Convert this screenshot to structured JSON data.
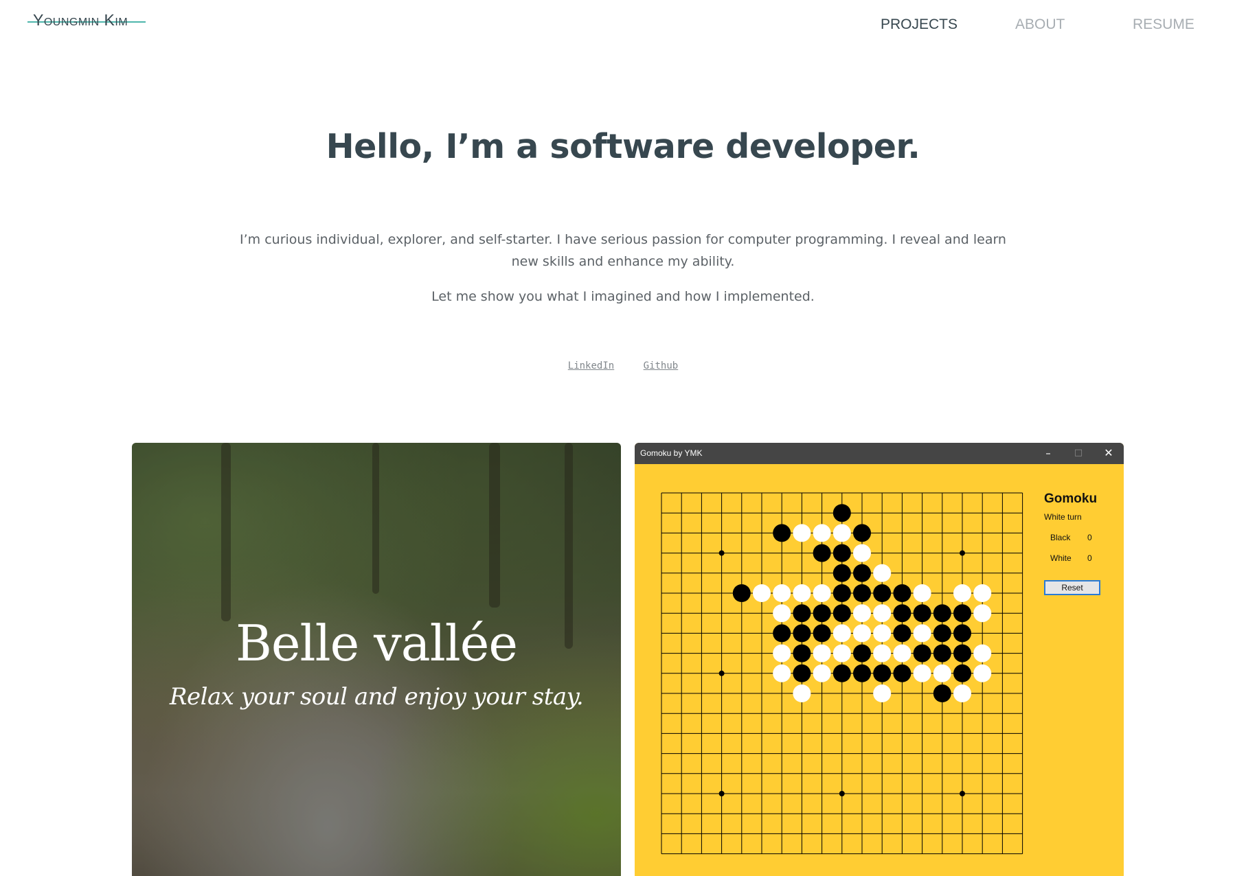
{
  "header": {
    "logo": "Youngmin Kim",
    "nav": {
      "projects": "PROJECTS",
      "about": "ABOUT",
      "resume": "RESUME"
    },
    "colors": {
      "active": "#37474f",
      "inactive": "#a7adb2",
      "accent": "#4db6ac"
    }
  },
  "hero": {
    "title": "Hello, I’m a software developer.",
    "intro": "I’m curious individual, explorer, and self-starter. I have serious passion for computer programming. I reveal and learn new skills and enhance my ability.",
    "tagline": "Let me show you what I imagined and how I implemented.",
    "links": {
      "linkedin": "LinkedIn",
      "github": "Github"
    }
  },
  "projects": {
    "belle": {
      "title": "Belle vallée",
      "subtitle": "Relax your soul and enjoy your stay."
    },
    "gomoku": {
      "window_title": "Gomoku by YMK",
      "window_buttons": {
        "minimize": "–",
        "maximize": "□",
        "close": "✕"
      },
      "heading": "Gomoku",
      "turn": "White turn",
      "score_black_label": "Black",
      "score_black": "0",
      "score_white_label": "White",
      "score_white": "0",
      "reset_label": "Reset",
      "board_color": "#ffcd33",
      "grid_size": 19,
      "black_stones": [
        [
          9,
          1
        ],
        [
          6,
          2
        ],
        [
          10,
          2
        ],
        [
          8,
          3
        ],
        [
          9,
          3
        ],
        [
          9,
          4
        ],
        [
          10,
          4
        ],
        [
          4,
          5
        ],
        [
          9,
          5
        ],
        [
          10,
          5
        ],
        [
          11,
          5
        ],
        [
          12,
          5
        ],
        [
          7,
          6
        ],
        [
          8,
          6
        ],
        [
          9,
          6
        ],
        [
          12,
          6
        ],
        [
          13,
          6
        ],
        [
          14,
          6
        ],
        [
          15,
          6
        ],
        [
          6,
          7
        ],
        [
          7,
          7
        ],
        [
          8,
          7
        ],
        [
          12,
          7
        ],
        [
          14,
          7
        ],
        [
          15,
          7
        ],
        [
          7,
          8
        ],
        [
          10,
          8
        ],
        [
          13,
          8
        ],
        [
          14,
          8
        ],
        [
          15,
          8
        ],
        [
          7,
          9
        ],
        [
          9,
          9
        ],
        [
          10,
          9
        ],
        [
          11,
          9
        ],
        [
          12,
          9
        ],
        [
          15,
          9
        ],
        [
          14,
          10
        ]
      ],
      "white_stones": [
        [
          7,
          2
        ],
        [
          8,
          2
        ],
        [
          9,
          2
        ],
        [
          10,
          3
        ],
        [
          11,
          4
        ],
        [
          5,
          5
        ],
        [
          6,
          5
        ],
        [
          7,
          5
        ],
        [
          8,
          5
        ],
        [
          13,
          5
        ],
        [
          15,
          5
        ],
        [
          16,
          5
        ],
        [
          6,
          6
        ],
        [
          10,
          6
        ],
        [
          11,
          6
        ],
        [
          16,
          6
        ],
        [
          9,
          7
        ],
        [
          10,
          7
        ],
        [
          11,
          7
        ],
        [
          13,
          7
        ],
        [
          6,
          8
        ],
        [
          8,
          8
        ],
        [
          9,
          8
        ],
        [
          11,
          8
        ],
        [
          12,
          8
        ],
        [
          16,
          8
        ],
        [
          6,
          9
        ],
        [
          8,
          9
        ],
        [
          13,
          9
        ],
        [
          14,
          9
        ],
        [
          16,
          9
        ],
        [
          7,
          10
        ],
        [
          11,
          10
        ],
        [
          15,
          10
        ]
      ],
      "star_points": [
        [
          3,
          3
        ],
        [
          15,
          3
        ],
        [
          3,
          9
        ],
        [
          3,
          15
        ],
        [
          9,
          15
        ],
        [
          15,
          15
        ]
      ]
    }
  }
}
